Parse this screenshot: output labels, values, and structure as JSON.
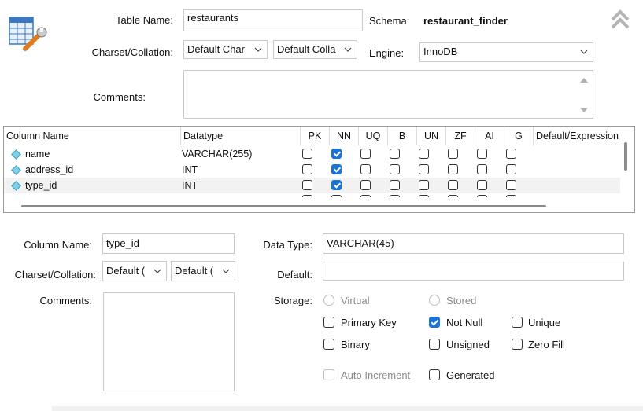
{
  "table": {
    "name_label": "Table Name:",
    "name_value": "restaurants",
    "schema_label": "Schema:",
    "schema_value": "restaurant_finder",
    "charset_label": "Charset/Collation:",
    "charset_value": "Default Char",
    "collation_value": "Default Colla",
    "engine_label": "Engine:",
    "engine_value": "InnoDB",
    "comments_label": "Comments:"
  },
  "grid": {
    "headers": [
      "Column Name",
      "Datatype",
      "PK",
      "NN",
      "UQ",
      "B",
      "UN",
      "ZF",
      "AI",
      "G",
      "Default/Expression"
    ],
    "rows": [
      {
        "name": "name",
        "type": "VARCHAR(255)",
        "flags": [
          false,
          true,
          false,
          false,
          false,
          false,
          false,
          false
        ]
      },
      {
        "name": "address_id",
        "type": "INT",
        "flags": [
          false,
          true,
          false,
          false,
          false,
          false,
          false,
          false
        ]
      },
      {
        "name": "type_id",
        "type": "INT",
        "flags": [
          false,
          true,
          false,
          false,
          false,
          false,
          false,
          false
        ]
      }
    ]
  },
  "column": {
    "name_label": "Column Name:",
    "name_value": "type_id",
    "datatype_label": "Data Type:",
    "datatype_value": "VARCHAR(45)",
    "charset_label": "Charset/Collation:",
    "charset_value": "Default (",
    "collation_value": "Default (",
    "default_label": "Default:",
    "default_value": "",
    "comments_label": "Comments:",
    "storage_label": "Storage:",
    "virtual_label": "Virtual",
    "stored_label": "Stored",
    "primary_key_label": "Primary Key",
    "not_null_label": "Not Null",
    "unique_label": "Unique",
    "binary_label": "Binary",
    "unsigned_label": "Unsigned",
    "zero_fill_label": "Zero Fill",
    "auto_increment_label": "Auto Increment",
    "generated_label": "Generated",
    "checks": {
      "primary_key": false,
      "not_null": true,
      "unique": false,
      "binary": false,
      "unsigned": false,
      "zero_fill": false,
      "auto_increment": false,
      "generated": false
    }
  },
  "icons": {
    "table_icon": "table-wrench-icon",
    "collapse_icon": "double-chevron-up-icon"
  },
  "colors": {
    "accent": "#1a73d9",
    "diamond": "#7fd0e6"
  }
}
